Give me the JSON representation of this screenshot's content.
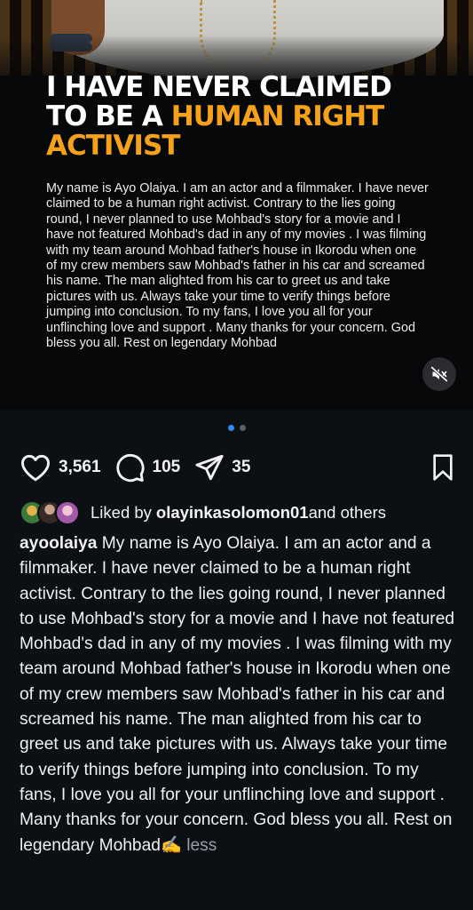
{
  "post": {
    "headline_white": "I HAVE NEVER CLAIMED TO BE A ",
    "headline_accent": "HUMAN RIGHT ACTIVIST",
    "image_text": "My name is Ayo Olaiya. I am an actor and a filmmaker. I have never claimed to be a human right activist. Contrary to the lies going round, I never planned to use Mohbad's story for a movie and I have not featured Mohbad's dad in any of my movies . I was filming with my team around Mohbad father's house in Ikorodu when one of my crew members saw Mohbad's father in his car and screamed his name. The man alighted from his car to greet us and take pictures with us. Always take your time to verify things before jumping into conclusion.  To my fans, I love you all for your unflinching love and support . Many thanks for your concern. God bless you all.  Rest on legendary Mohbad",
    "accent_color": "#f5a21a",
    "mute_icon": "muted-speaker-icon"
  },
  "carousel": {
    "current": 1,
    "total": 2
  },
  "actions": {
    "likes": "3,561",
    "comments": "105",
    "shares": "35",
    "icons": [
      "heart-icon",
      "comment-icon",
      "share-icon",
      "bookmark-icon"
    ]
  },
  "liked_by": {
    "prefix": "Liked by ",
    "user": "olayinkasolomon01",
    "suffix": " and others"
  },
  "caption": {
    "username": "ayoolaiya",
    "text": " My name is Ayo Olaiya. I am an actor and a filmmaker. I have never claimed to be a human right activist. Contrary to the lies going round, I never planned to use Mohbad's story for a movie and I have not featured Mohbad's dad in any of my movies . I was filming with my team around Mohbad father's house in Ikorodu when one of my crew members saw Mohbad's father in his car and screamed his name. The man alighted from his car to greet us and take pictures with us. Always take your time to verify things before jumping into conclusion.  To my fans, I love you all for your unflinching love and support . Many thanks for your concern. God bless you all.  Rest on legendary Mohbad",
    "emoji": "✍️",
    "less_label": " less"
  }
}
